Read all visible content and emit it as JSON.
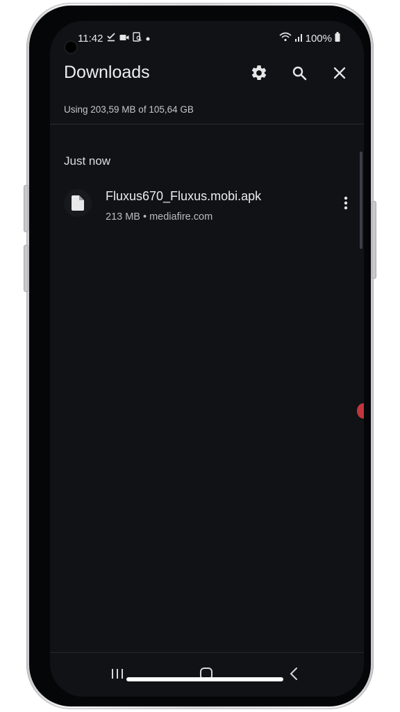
{
  "status_bar": {
    "time": "11:42",
    "battery": "100%",
    "left_icons": [
      "check-download-icon",
      "video-icon",
      "screenshot-icon",
      "dot-icon"
    ],
    "right_icons": [
      "wifi-icon",
      "signal-icon",
      "battery-icon"
    ]
  },
  "app_bar": {
    "title": "Downloads",
    "actions": [
      "gear-icon",
      "search-icon",
      "close-icon"
    ]
  },
  "storage": {
    "text": "Using 203,59 MB of 105,64 GB"
  },
  "sections": [
    {
      "label": "Just now",
      "items": [
        {
          "icon": "file-icon",
          "name": "Fluxus670_Fluxus.mobi.apk",
          "meta": "213 MB • mediafire.com"
        }
      ]
    }
  ],
  "nav_bar": {
    "buttons": [
      "recents-icon",
      "home-icon",
      "back-icon"
    ]
  },
  "colors": {
    "background": "#101216",
    "text_primary": "#ececee",
    "text_secondary": "#b9bbbf",
    "accent_dot": "#c1363d"
  }
}
